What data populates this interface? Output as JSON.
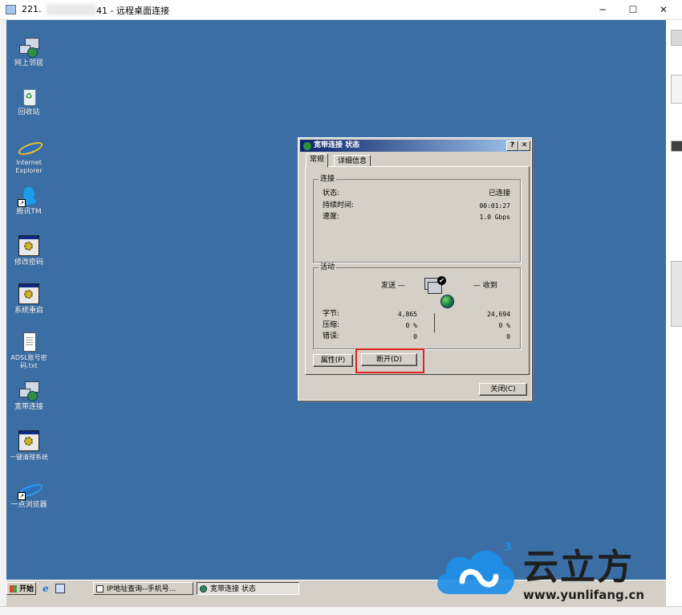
{
  "window": {
    "title_left": "221.",
    "title_right": "41 - 远程桌面连接",
    "minimize_glyph": "─",
    "maximize_glyph": "☐",
    "close_glyph": "✕"
  },
  "desktop_icons": [
    {
      "label": "网上邻居",
      "icon": "network-neighborhood-icon"
    },
    {
      "label": "回收站",
      "icon": "recycle-bin-icon"
    },
    {
      "label": "Internet Explorer",
      "icon": "internet-explorer-icon"
    },
    {
      "label": "腾讯TM",
      "icon": "tencent-tm-icon"
    },
    {
      "label": "修改密码",
      "icon": "change-password-app-icon"
    },
    {
      "label": "系统重启",
      "icon": "system-restart-app-icon"
    },
    {
      "label": "ADSL账号密码.txt",
      "icon": "text-file-icon"
    },
    {
      "label": "宽带连接",
      "icon": "broadband-connection-icon"
    },
    {
      "label": "一键清理系统",
      "icon": "one-click-cleanup-app-icon"
    },
    {
      "label": "一点浏览器",
      "icon": "yidian-browser-icon"
    }
  ],
  "dialog": {
    "title": "宽带连接 状态",
    "help_glyph": "?",
    "close_glyph": "✕",
    "tabs": [
      "常规",
      "详细信息"
    ],
    "connection": {
      "group_label": "连接",
      "rows": [
        {
          "label": "状态:",
          "value": "已连接"
        },
        {
          "label": "持续时间:",
          "value": "00:01:27"
        },
        {
          "label": "速度:",
          "value": "1.0 Gbps"
        }
      ]
    },
    "activity": {
      "group_label": "活动",
      "sent_label": "发送 —",
      "received_label": "— 收到",
      "rows": [
        {
          "label": "字节:",
          "sent": "4,865",
          "received": "24,694"
        },
        {
          "label": "压缩:",
          "sent": "0 %",
          "received": "0 %"
        },
        {
          "label": "错误:",
          "sent": "0",
          "received": "0"
        }
      ]
    },
    "properties_button": "属性(P)",
    "disconnect_button": "断开(D)",
    "close_button": "关闭(C)"
  },
  "taskbar": {
    "start_label": "开始",
    "tasks": [
      {
        "label": "IP地址查询--手机号..."
      },
      {
        "label": "宽带连接 状态"
      }
    ]
  },
  "watermark": {
    "brand": "云立方",
    "url": "www.yunlifang.cn",
    "superscript": "3"
  },
  "colors": {
    "desktop": "#3a6ea5",
    "dialog_face": "#d4d0c8",
    "title_gradient_start": "#0a246a",
    "highlight_red": "#e02020",
    "watermark_blue": "#1e8ee8"
  }
}
